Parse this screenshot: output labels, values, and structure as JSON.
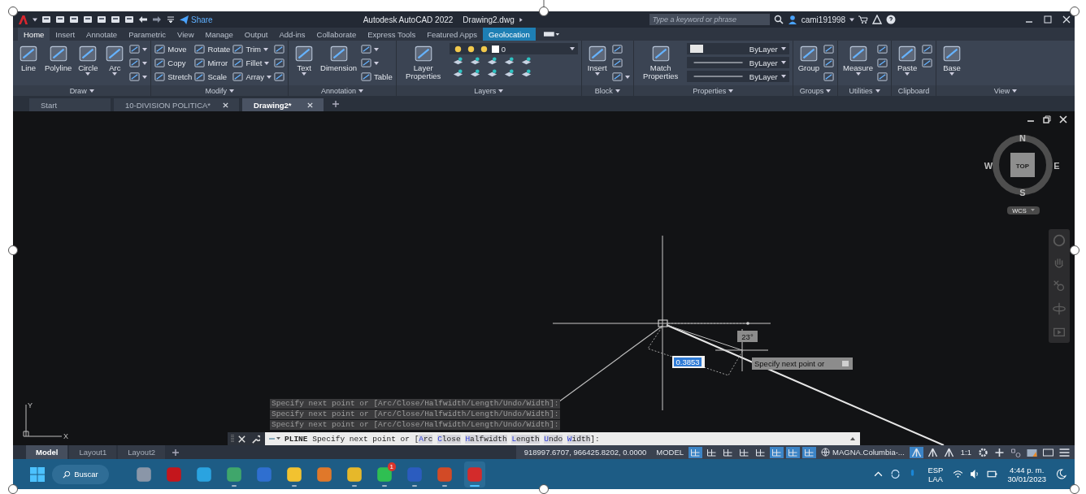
{
  "title_bar": {
    "share": "Share",
    "app_title": "Autodesk AutoCAD 2022",
    "file_title": "Drawing2.dwg",
    "search": {
      "placeholder": "Type a keyword or phrase"
    },
    "user": "cami191998"
  },
  "ribbon_tabs": [
    {
      "label": "Home",
      "selected": true,
      "kind": "standard"
    },
    {
      "label": "Insert",
      "selected": false,
      "kind": "standard"
    },
    {
      "label": "Annotate",
      "selected": false,
      "kind": "standard"
    },
    {
      "label": "Parametric",
      "selected": false,
      "kind": "standard"
    },
    {
      "label": "View",
      "selected": false,
      "kind": "standard"
    },
    {
      "label": "Manage",
      "selected": false,
      "kind": "standard"
    },
    {
      "label": "Output",
      "selected": false,
      "kind": "standard"
    },
    {
      "label": "Add-ins",
      "selected": false,
      "kind": "standard"
    },
    {
      "label": "Collaborate",
      "selected": false,
      "kind": "standard"
    },
    {
      "label": "Express Tools",
      "selected": false,
      "kind": "standard"
    },
    {
      "label": "Featured Apps",
      "selected": false,
      "kind": "standard"
    },
    {
      "label": "Geolocation",
      "selected": false,
      "kind": "contextual"
    }
  ],
  "panels": [
    {
      "title": "Draw",
      "has_menu": true,
      "tools": [
        {
          "kind": "large",
          "label": "Line",
          "has_menu": false
        },
        {
          "kind": "large",
          "label": "Polyline",
          "has_menu": false
        },
        {
          "kind": "large",
          "label": "Circle",
          "has_menu": true
        },
        {
          "kind": "large",
          "label": "Arc",
          "has_menu": true
        },
        {
          "kind": "column",
          "items": [
            {
              "kind": "icon",
              "has_menu": true
            },
            {
              "kind": "icon",
              "has_menu": true
            },
            {
              "kind": "icon",
              "has_menu": true
            }
          ]
        }
      ]
    },
    {
      "title": "Modify",
      "has_menu": true,
      "tools": [
        {
          "kind": "column",
          "items": [
            {
              "kind": "tool",
              "label": "Move",
              "has_menu": false
            },
            {
              "kind": "tool",
              "label": "Copy",
              "has_menu": false
            },
            {
              "kind": "tool",
              "label": "Stretch",
              "has_menu": false
            }
          ]
        },
        {
          "kind": "column",
          "items": [
            {
              "kind": "tool",
              "label": "Rotate",
              "has_menu": false
            },
            {
              "kind": "tool",
              "label": "Mirror",
              "has_menu": false
            },
            {
              "kind": "tool",
              "label": "Scale",
              "has_menu": false
            }
          ]
        },
        {
          "kind": "column",
          "items": [
            {
              "kind": "tool",
              "label": "Trim",
              "has_menu": true
            },
            {
              "kind": "tool",
              "label": "Fillet",
              "has_menu": true
            },
            {
              "kind": "tool",
              "label": "Array",
              "has_menu": true
            }
          ]
        },
        {
          "kind": "column",
          "items": [
            {
              "kind": "icon",
              "has_menu": false
            },
            {
              "kind": "icon",
              "has_menu": false
            },
            {
              "kind": "icon",
              "has_menu": false
            }
          ]
        }
      ]
    },
    {
      "title": "Annotation",
      "has_menu": true,
      "tools": [
        {
          "kind": "large",
          "label": "Text",
          "has_menu": true
        },
        {
          "kind": "large",
          "label": "Dimension",
          "has_menu": false
        },
        {
          "kind": "column",
          "items": [
            {
              "kind": "icon",
              "has_menu": true
            },
            {
              "kind": "icon",
              "has_menu": true
            },
            {
              "kind": "tool",
              "label": "Table",
              "has_menu": false
            }
          ]
        }
      ]
    },
    {
      "title": "Layers",
      "has_menu": true,
      "tools": [
        {
          "kind": "large",
          "label": "Layer Properties",
          "has_menu": false
        },
        {
          "kind": "layer",
          "value": "0"
        }
      ]
    },
    {
      "title": "Block",
      "has_menu": true,
      "tools": [
        {
          "kind": "large",
          "label": "Insert",
          "has_menu": true
        },
        {
          "kind": "column",
          "items": [
            {
              "kind": "icon",
              "has_menu": false
            },
            {
              "kind": "icon",
              "has_menu": false
            },
            {
              "kind": "icon",
              "has_menu": true
            }
          ]
        }
      ]
    },
    {
      "title": "Properties",
      "has_menu": true,
      "tools": [
        {
          "kind": "large",
          "label": "Match Properties",
          "has_menu": false
        },
        {
          "kind": "dropdowns",
          "items": [
            {
              "kind": "color",
              "value": "ByLayer"
            },
            {
              "kind": "line",
              "value": "ByLayer"
            },
            {
              "kind": "line",
              "value": "ByLayer"
            }
          ]
        }
      ]
    },
    {
      "title": "Groups",
      "has_menu": true,
      "tools": [
        {
          "kind": "large",
          "label": "Group",
          "has_menu": false
        },
        {
          "kind": "column",
          "items": [
            {
              "kind": "icon",
              "has_menu": false
            },
            {
              "kind": "icon",
              "has_menu": false
            },
            {
              "kind": "icon",
              "has_menu": false
            }
          ]
        }
      ]
    },
    {
      "title": "Utilities",
      "has_menu": true,
      "tools": [
        {
          "kind": "large",
          "label": "Measure",
          "has_menu": true
        },
        {
          "kind": "column",
          "items": [
            {
              "kind": "icon",
              "has_menu": false
            },
            {
              "kind": "icon",
              "has_menu": false
            },
            {
              "kind": "icon",
              "has_menu": false
            }
          ]
        }
      ]
    },
    {
      "title": "Clipboard",
      "has_menu": false,
      "tools": [
        {
          "kind": "large",
          "label": "Paste",
          "has_menu": true
        },
        {
          "kind": "column",
          "items": [
            {
              "kind": "icon",
              "has_menu": false
            },
            {
              "kind": "icon",
              "has_menu": false
            }
          ]
        }
      ]
    },
    {
      "title": "View",
      "has_menu": true,
      "tools": [
        {
          "kind": "large",
          "label": "Base",
          "has_menu": true
        }
      ]
    }
  ],
  "doc_tabs": [
    {
      "label": "Start",
      "selected": false,
      "closable": false
    },
    {
      "label": "10-DIVISION POLITICA*",
      "selected": false,
      "closable": true
    },
    {
      "label": "Drawing2*",
      "selected": true,
      "closable": true
    }
  ],
  "viewport": {
    "viewcube": {
      "face": "TOP",
      "north": "N",
      "south": "S",
      "east": "E",
      "west": "W",
      "ucs": "WCS"
    },
    "ucs_icon": {
      "x": "X",
      "y": "Y"
    },
    "angle": "23°",
    "length_input": "0.3853",
    "tooltip": "Specify next point or"
  },
  "command_history": [
    "Specify next point or [Arc/Close/Halfwidth/Length/Undo/Width]:",
    "Specify next point or [Arc/Close/Halfwidth/Length/Undo/Width]:",
    "Specify next point or [Arc/Close/Halfwidth/Length/Undo/Width]:"
  ],
  "command_line": {
    "command": "PLINE",
    "prompt": "Specify next point or [",
    "options": [
      "Arc",
      "Close",
      "Halfwidth",
      "Length",
      "Undo",
      "Width"
    ],
    "suffix": "]:"
  },
  "layout_tabs": [
    {
      "label": "Model",
      "selected": true
    },
    {
      "label": "Layout1",
      "selected": false
    },
    {
      "label": "Layout2",
      "selected": false
    }
  ],
  "status_bar": {
    "coordinates": "918997.6707, 966425.8202, 0.0000",
    "space": "MODEL",
    "toggles": [
      {
        "on": true
      },
      {
        "on": false
      },
      {
        "on": false
      },
      {
        "on": false
      },
      {
        "on": false
      },
      {
        "on": true
      },
      {
        "on": true
      },
      {
        "on": true
      }
    ],
    "coordinate_system": "MAGNA.Columbia-...",
    "annotation": [
      {
        "on": true
      },
      {
        "on": false
      },
      {
        "on": false
      }
    ],
    "scale": "1:1"
  },
  "taskbar": {
    "search": "Buscar",
    "apps": [
      {
        "color": "#8a96a8",
        "running": false,
        "selected": false
      },
      {
        "color": "#c4161c",
        "running": false,
        "selected": false
      },
      {
        "color": "#2aa3e0",
        "running": false,
        "selected": false
      },
      {
        "color": "#3fa66b",
        "running": true,
        "selected": false
      },
      {
        "color": "#2f6fd0",
        "running": false,
        "selected": false
      },
      {
        "color": "#f2c230",
        "running": true,
        "selected": false
      },
      {
        "color": "#e0782a",
        "running": false,
        "selected": false
      },
      {
        "color": "#e6b82a",
        "running": true,
        "selected": false
      },
      {
        "color": "#2fbf52",
        "running": true,
        "selected": false,
        "badge": "1"
      },
      {
        "color": "#2b5cbf",
        "running": true,
        "selected": false
      },
      {
        "color": "#d24a26",
        "running": true,
        "selected": false
      },
      {
        "color": "#d32b2b",
        "running": true,
        "selected": true
      }
    ],
    "language": "ESP",
    "region": "LAA",
    "time": "4:44 p. m.",
    "date": "30/01/2023"
  }
}
